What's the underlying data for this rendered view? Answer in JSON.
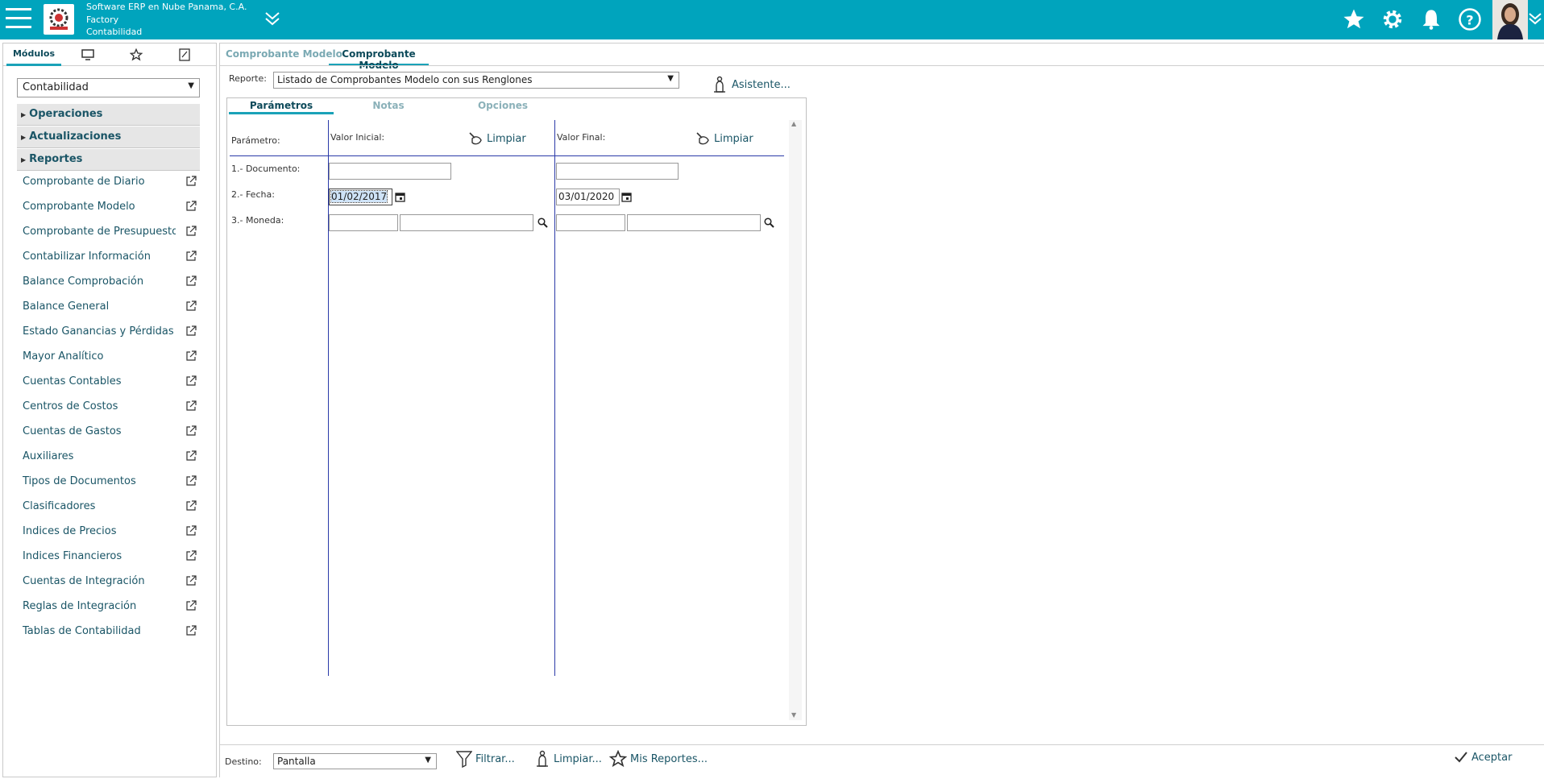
{
  "header": {
    "company_line1": "Software ERP en Nube Panama, C.A.",
    "company_line2": "Factory",
    "company_line3": "Contabilidad",
    "brand_color": "#00a4bd",
    "icons": [
      "menu-icon",
      "logo",
      "double-chevron-icon",
      "star-icon",
      "gear-icon",
      "bell-icon",
      "help-icon",
      "avatar",
      "chevron-down-icon"
    ]
  },
  "sidebar": {
    "tabs": [
      {
        "label": "Módulos",
        "icon": null
      },
      {
        "label": "",
        "icon": "monitor-icon"
      },
      {
        "label": "",
        "icon": "star-icon"
      },
      {
        "label": "",
        "icon": "note-icon"
      }
    ],
    "module_value": "Contabilidad",
    "sections": [
      "Operaciones",
      "Actualizaciones",
      "Reportes"
    ],
    "items": [
      "Comprobante de Diario",
      "Comprobante Modelo",
      "Comprobante de Presupuesto",
      "Contabilizar Información",
      "Balance Comprobación",
      "Balance General",
      "Estado Ganancias y Pérdidas",
      "Mayor Analítico",
      "Cuentas Contables",
      "Centros de Costos",
      "Cuentas de Gastos",
      "Auxiliares",
      "Tipos de Documentos",
      "Clasificadores",
      "Indices de Precios",
      "Indices Financieros",
      "Cuentas de Integración",
      "Reglas de Integración",
      "Tablas de Contabilidad"
    ]
  },
  "main": {
    "doc_tabs": [
      "Comprobante Modelo",
      "Comprobante Modelo"
    ],
    "report_label": "Reporte:",
    "report_value": "Listado de Comprobantes Modelo con sus Renglones",
    "wizard_label": "Asistente...",
    "panel_tabs": [
      "Parámetros",
      "Notas",
      "Opciones"
    ],
    "param_header": "Parámetro:",
    "initial_header": "Valor Inicial:",
    "final_header": "Valor Final:",
    "clear_label": "Limpiar",
    "rows": [
      {
        "label": "1.- Documento:",
        "initial": "",
        "final": ""
      },
      {
        "label": "2.- Fecha:",
        "initial": "01/02/2017",
        "final": "03/01/2020"
      },
      {
        "label": "3.- Moneda:",
        "initial": "",
        "final": ""
      }
    ]
  },
  "footer": {
    "dest_label": "Destino:",
    "dest_value": "Pantalla",
    "filter_label": "Filtrar...",
    "clear_label": "Limpiar...",
    "myreports_label": "Mis Reportes...",
    "accept_label": "Aceptar"
  }
}
